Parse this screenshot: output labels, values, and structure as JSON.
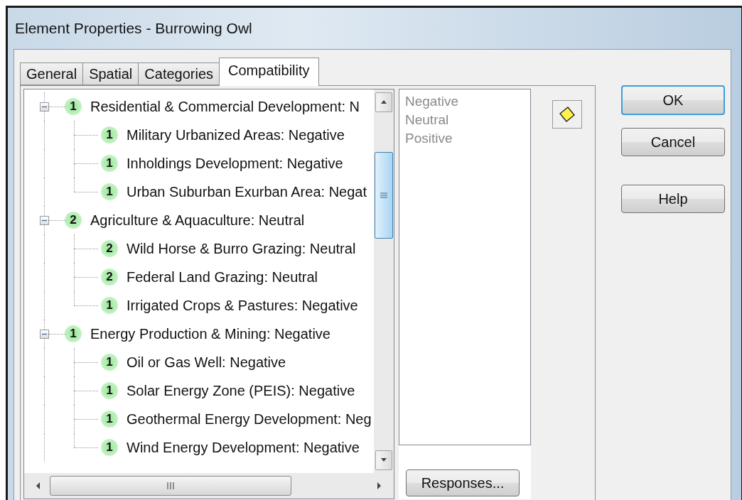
{
  "window": {
    "title": "Element Properties - Burrowing Owl"
  },
  "tabs": [
    {
      "label": "General",
      "selected": false
    },
    {
      "label": "Spatial",
      "selected": false
    },
    {
      "label": "Categories",
      "selected": false
    },
    {
      "label": "Compatibility",
      "selected": true
    }
  ],
  "tree": [
    {
      "badge": "1",
      "label": "Residential & Commercial Development: N",
      "expanded": true,
      "children": [
        {
          "badge": "1",
          "label": "Military Urbanized Areas: Negative"
        },
        {
          "badge": "1",
          "label": "Inholdings Development: Negative"
        },
        {
          "badge": "1",
          "label": "Urban Suburban Exurban Area: Negat"
        }
      ]
    },
    {
      "badge": "2",
      "label": "Agriculture & Aquaculture: Neutral",
      "expanded": true,
      "children": [
        {
          "badge": "2",
          "label": "Wild Horse & Burro Grazing: Neutral"
        },
        {
          "badge": "2",
          "label": "Federal Land Grazing: Neutral"
        },
        {
          "badge": "1",
          "label": "Irrigated Crops & Pastures: Negative"
        }
      ]
    },
    {
      "badge": "1",
      "label": "Energy Production & Mining: Negative",
      "expanded": true,
      "children": [
        {
          "badge": "1",
          "label": "Oil or Gas Well: Negative"
        },
        {
          "badge": "1",
          "label": "Solar Energy Zone (PEIS): Negative"
        },
        {
          "badge": "1",
          "label": "Geothermal Energy Development: Neg"
        },
        {
          "badge": "1",
          "label": "Wind Energy Development: Negative"
        }
      ]
    }
  ],
  "responses_list": [
    "Negative",
    "Neutral",
    "Positive"
  ],
  "responses_button": "Responses...",
  "buttons": [
    {
      "label": "OK",
      "default": true
    },
    {
      "label": "Cancel",
      "default": false
    },
    {
      "label": "Help",
      "default": false
    }
  ]
}
